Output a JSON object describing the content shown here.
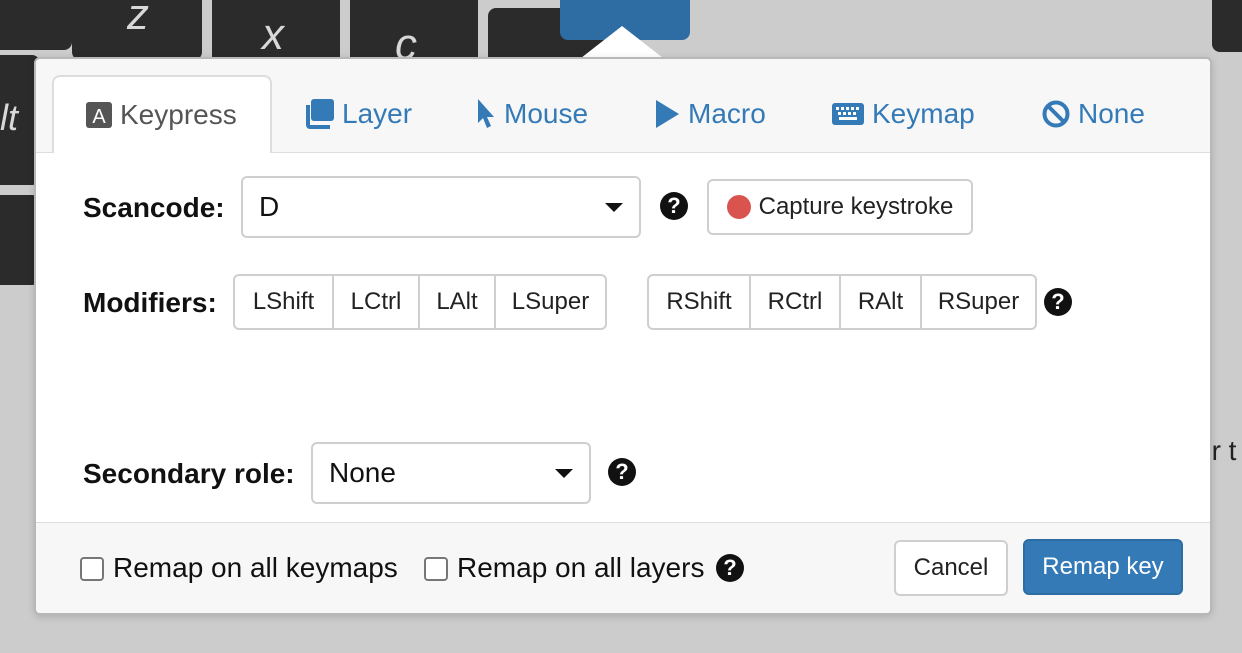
{
  "background": {
    "keys": [
      "z",
      "x",
      "c"
    ],
    "alt_fragment": "lt",
    "side_fragment": "er t"
  },
  "tabs": [
    {
      "label": "Keypress",
      "icon": "letter-a-icon",
      "active": true
    },
    {
      "label": "Layer",
      "icon": "layers-icon"
    },
    {
      "label": "Mouse",
      "icon": "mouse-pointer-icon"
    },
    {
      "label": "Macro",
      "icon": "play-icon"
    },
    {
      "label": "Keymap",
      "icon": "keyboard-icon"
    },
    {
      "label": "None",
      "icon": "ban-icon"
    }
  ],
  "scancode": {
    "label": "Scancode:",
    "value": "D",
    "capture_label": "Capture keystroke"
  },
  "modifiers": {
    "label": "Modifiers:",
    "left": [
      "LShift",
      "LCtrl",
      "LAlt",
      "LSuper"
    ],
    "right": [
      "RShift",
      "RCtrl",
      "RAlt",
      "RSuper"
    ]
  },
  "secondary": {
    "label": "Secondary role:",
    "value": "None"
  },
  "footer": {
    "remap_keymaps": "Remap on all keymaps",
    "remap_layers": "Remap on all layers",
    "cancel": "Cancel",
    "remap_key": "Remap key"
  },
  "colors": {
    "link": "#337ab7",
    "primary": "#337ab7",
    "record_dot": "#d9534f"
  }
}
